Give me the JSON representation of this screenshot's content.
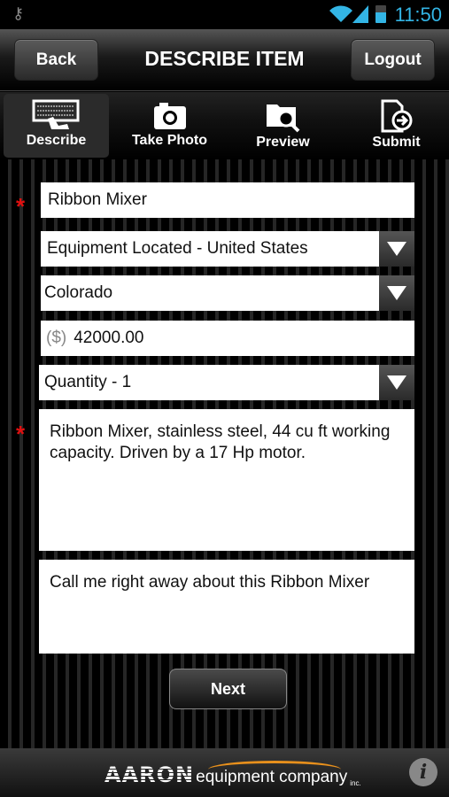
{
  "status": {
    "time": "11:50"
  },
  "header": {
    "title": "DESCRIBE ITEM",
    "back": "Back",
    "logout": "Logout"
  },
  "tabs": [
    {
      "label": "Describe"
    },
    {
      "label": "Take Photo"
    },
    {
      "label": "Preview"
    },
    {
      "label": "Submit"
    }
  ],
  "form": {
    "item_name": "Ribbon Mixer",
    "location": "Equipment Located - United States",
    "state": "Colorado",
    "currency_prefix": "($)",
    "price": "42000.00",
    "quantity": "Quantity - 1",
    "description": "Ribbon Mixer, stainless steel, 44 cu ft working capacity. Driven by a 17 Hp motor.",
    "message": "Call me right away about this Ribbon Mixer",
    "required_mark": "*",
    "next": "Next"
  },
  "footer": {
    "logo_text": "AARON",
    "logo_sub": "equipment company",
    "logo_inc": "inc.",
    "info_icon": "i"
  },
  "colors": {
    "accent": "#33b5e5",
    "required": "#e01010",
    "swoosh": "#e8901c"
  }
}
